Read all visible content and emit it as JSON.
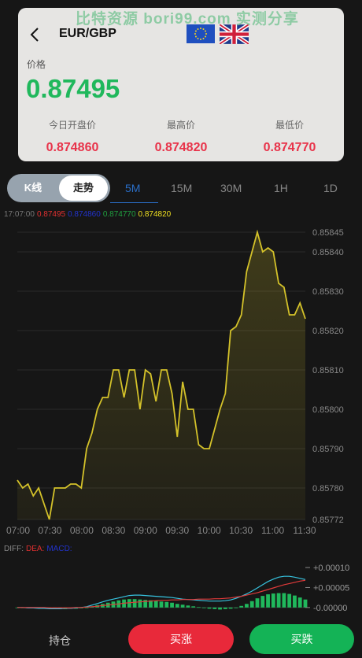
{
  "watermark": "比特资源 bori99.com 实测分享",
  "header": {
    "pair": "EUR/GBP",
    "price_label": "价格",
    "price": "0.87495",
    "stats": [
      {
        "label": "今日开盘价",
        "value": "0.874860"
      },
      {
        "label": "最高价",
        "value": "0.874820"
      },
      {
        "label": "最低价",
        "value": "0.874770"
      }
    ]
  },
  "chart_mode": {
    "kline": "K线",
    "trend": "走势",
    "active": "走势"
  },
  "timeframes": [
    "5M",
    "15M",
    "30M",
    "1H",
    "1D"
  ],
  "active_timeframe": "5M",
  "legend": {
    "time": "17:07:00",
    "values": [
      {
        "text": "0.87495",
        "color": "#e03030"
      },
      {
        "text": "0.874860",
        "color": "#2233cc"
      },
      {
        "text": "0.874770",
        "color": "#20a040"
      },
      {
        "text": "0.874820",
        "color": "#f0e020"
      }
    ]
  },
  "macd_legend": {
    "diff": "DIFF:",
    "dea": "DEA:",
    "macd": "MACD:"
  },
  "colors": {
    "up": "#20b85c",
    "down": "#e8334a",
    "line": "#d4c22a",
    "accent": "#2a6ec8"
  },
  "chart_data": [
    {
      "type": "area",
      "x_labels": [
        "07:00",
        "07:30",
        "08:00",
        "08:30",
        "09:00",
        "09:30",
        "10:00",
        "10:30",
        "11:00",
        "11:30"
      ],
      "y_ticks": [
        "0.85845",
        "0.85840",
        "0.85830",
        "0.85820",
        "0.85810",
        "0.85800",
        "0.85790",
        "0.85780",
        "0.85772"
      ],
      "ylim": [
        0.85772,
        0.85846
      ],
      "series": [
        {
          "values": [
            0.85782,
            0.8578,
            0.85781,
            0.85778,
            0.8578,
            0.85776,
            0.85772,
            0.8578,
            0.8578,
            0.8578,
            0.85781,
            0.85781,
            0.8578,
            0.8579,
            0.85794,
            0.858,
            0.85803,
            0.85803,
            0.8581,
            0.8581,
            0.85803,
            0.8581,
            0.8581,
            0.858,
            0.8581,
            0.85809,
            0.85802,
            0.8581,
            0.8581,
            0.85804,
            0.85793,
            0.85807,
            0.858,
            0.858,
            0.85791,
            0.8579,
            0.8579,
            0.85795,
            0.858,
            0.85804,
            0.8582,
            0.85821,
            0.85824,
            0.85835,
            0.8584,
            0.85845,
            0.8584,
            0.85841,
            0.8584,
            0.85832,
            0.85831,
            0.85824,
            0.85824,
            0.85827,
            0.85823
          ]
        }
      ]
    },
    {
      "type": "bar",
      "title": "MACD",
      "y_ticks": [
        "+0.00010",
        "+0.00005",
        "-0.00000"
      ],
      "ylim": [
        -2e-05,
        0.00011
      ],
      "series": [
        {
          "name": "MACD",
          "values": [
            0,
            0,
            0,
            -1e-06,
            -2e-06,
            -3e-06,
            -3e-06,
            -4e-06,
            -4e-06,
            -4e-06,
            -3e-06,
            -3e-06,
            -2e-06,
            0,
            3e-06,
            6e-06,
            9e-06,
            1.2e-05,
            1.5e-05,
            1.8e-05,
            2e-05,
            2.1e-05,
            2.1e-05,
            2e-05,
            1.9e-05,
            1.8e-05,
            1.7e-05,
            1.5e-05,
            1.4e-05,
            1.2e-05,
            9e-06,
            7e-06,
            5e-06,
            3e-06,
            1e-06,
            -1e-06,
            -3e-06,
            -4e-06,
            -5e-06,
            -4e-06,
            -3e-06,
            0,
            4e-06,
            9e-06,
            1.6e-05,
            2.3e-05,
            2.9e-05,
            3.3e-05,
            3.5e-05,
            3.6e-05,
            3.6e-05,
            3.4e-05,
            3e-05,
            2.5e-05,
            2e-05
          ]
        },
        {
          "name": "DIFF",
          "values": [
            0,
            0,
            -1e-06,
            -1e-06,
            -2e-06,
            -2e-06,
            -3e-06,
            -3e-06,
            -3e-06,
            -2e-06,
            -2e-06,
            -1e-06,
            0,
            2e-06,
            6e-06,
            1e-05,
            1.4e-05,
            1.8e-05,
            2.1e-05,
            2.4e-05,
            2.7e-05,
            3e-05,
            3.1e-05,
            3.1e-05,
            3e-05,
            2.9e-05,
            2.8e-05,
            2.7e-05,
            2.6e-05,
            2.5e-05,
            2.3e-05,
            2.1e-05,
            2e-05,
            1.9e-05,
            1.8e-05,
            1.7e-05,
            1.6e-05,
            1.6e-05,
            1.6e-05,
            1.7e-05,
            1.9e-05,
            2.3e-05,
            2.8e-05,
            3.4e-05,
            4.1e-05,
            4.9e-05,
            5.7e-05,
            6.5e-05,
            7.1e-05,
            7.6e-05,
            7.8e-05,
            7.8e-05,
            7.6e-05,
            7.3e-05,
            7e-05
          ]
        },
        {
          "name": "DEA",
          "values": [
            0,
            0,
            0,
            0,
            0,
            0,
            -1e-06,
            -1e-06,
            -1e-06,
            -1e-06,
            -1e-06,
            0,
            0,
            1e-06,
            2e-06,
            3e-06,
            5e-06,
            6e-06,
            8e-06,
            9e-06,
            1.1e-05,
            1.2e-05,
            1.3e-05,
            1.4e-05,
            1.5e-05,
            1.6e-05,
            1.7e-05,
            1.8e-05,
            1.8e-05,
            1.9e-05,
            1.9e-05,
            2e-05,
            2e-05,
            2e-05,
            2.1e-05,
            2.1e-05,
            2.1e-05,
            2.2e-05,
            2.2e-05,
            2.3e-05,
            2.4e-05,
            2.6e-05,
            2.8e-05,
            3.1e-05,
            3.4e-05,
            3.7e-05,
            4.1e-05,
            4.5e-05,
            4.9e-05,
            5.3e-05,
            5.7e-05,
            6e-05,
            6.3e-05,
            6.6e-05,
            6.8e-05
          ]
        }
      ]
    }
  ],
  "footer": {
    "hold": "持仓",
    "buy_up": "买涨",
    "buy_down": "买跌"
  }
}
